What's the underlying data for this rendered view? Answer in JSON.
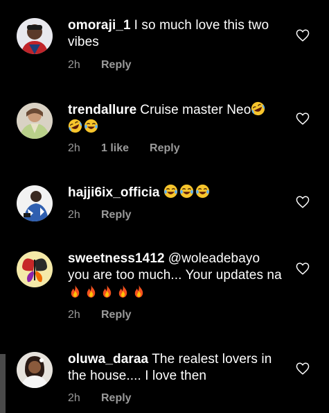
{
  "comments": [
    {
      "username": "omoraji_1",
      "text": "I so much love this two vibes",
      "emojis": [],
      "time": "2h",
      "likes": "",
      "reply": "Reply",
      "avatar": "person-avatar"
    },
    {
      "username": "trendallure",
      "text": "Cruise master Neo",
      "emojis": [
        "rofl",
        "rofl",
        "joy"
      ],
      "time": "2h",
      "likes": "1 like",
      "reply": "Reply",
      "avatar": "person-avatar"
    },
    {
      "username": "hajji6ix_officia",
      "text": "",
      "emojis": [
        "joy",
        "joy",
        "joy"
      ],
      "time": "2h",
      "likes": "",
      "reply": "Reply",
      "avatar": "person-avatar"
    },
    {
      "username": "sweetness1412",
      "text": "@woleadebayo you are too much... Your updates na",
      "emojis": [
        "fire",
        "fire",
        "fire",
        "fire",
        "fire"
      ],
      "time": "2h",
      "likes": "",
      "reply": "Reply",
      "avatar": "butterfly-logo-avatar"
    },
    {
      "username": "oluwa_daraa",
      "text": "The realest lovers in the house.... I love then",
      "emojis": [],
      "time": "2h",
      "likes": "",
      "reply": "Reply",
      "avatar": "person-avatar"
    }
  ],
  "icons": {
    "like": "heart-outline-icon"
  },
  "colors": {
    "background": "#000000",
    "text": "#ffffff",
    "meta": "#9a9a9a"
  }
}
